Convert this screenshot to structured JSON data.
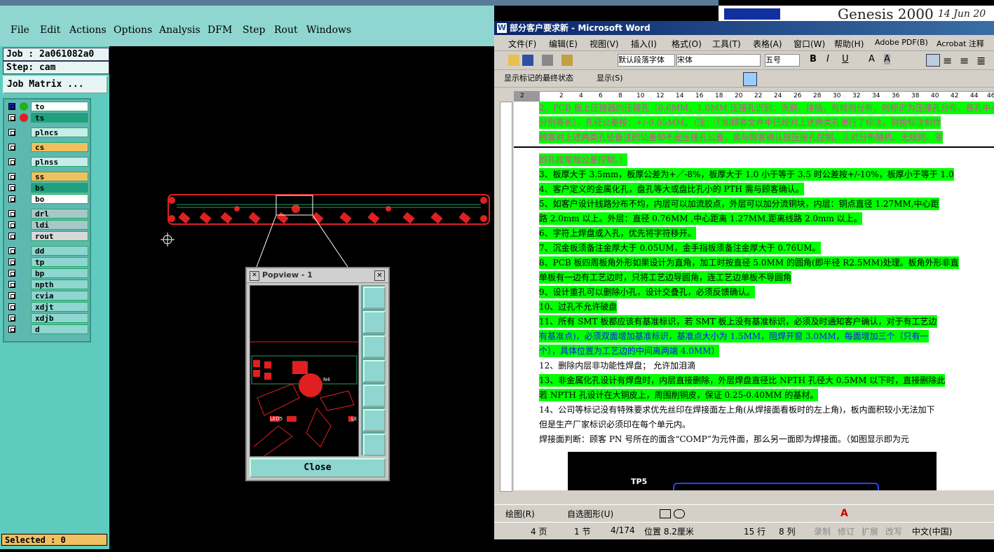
{
  "genesis": {
    "menu": [
      "File",
      "Edit",
      "Actions",
      "Options",
      "Analysis",
      "DFM",
      "Step",
      "Rout",
      "Windows"
    ],
    "job": "Job : 2a061082a0",
    "step": "Step: cam",
    "job_matrix_button": "Job Matrix ...",
    "layers": [
      "to",
      "ts",
      "plncs",
      "cs",
      "plnss",
      "ss",
      "bs",
      "bo",
      "drl",
      "ldi",
      "rout",
      "dd",
      "tp",
      "bp",
      "npth",
      "cvia",
      "xdjt",
      "xdjb",
      "d"
    ],
    "selected": "Selected : 0",
    "brand": "Genesis 2000",
    "date": "14 Jun 20",
    "popview": {
      "title": "Popview - 1",
      "close": "Close",
      "labels": [
        "LED5",
        "LE",
        "N4"
      ]
    }
  },
  "word": {
    "title": "部分客户要求新 - Microsoft Word",
    "menu": [
      "文件(F)",
      "编辑(E)",
      "视图(V)",
      "插入(I)",
      "格式(O)",
      "工具(T)",
      "表格(A)",
      "窗口(W)",
      "帮助(H)",
      "Adobe PDF(B)",
      "Acrobat 注释"
    ],
    "style_box": "默认段落字体",
    "font_box": "宋体",
    "size_box": "五号",
    "review_box": "显示标记的最终状态",
    "show_button": "显示(S)",
    "draw_label": "绘图(R)",
    "autoshape_label": "自选图形(U)",
    "ruler_numbers": [
      "2",
      "2",
      "4",
      "6",
      "8",
      "10",
      "12",
      "14",
      "16",
      "18",
      "20",
      "22",
      "24",
      "26",
      "28",
      "30",
      "32",
      "34",
      "36",
      "38",
      "40",
      "42",
      "44",
      "46"
    ],
    "lines": [
      {
        "t": "2、PCB 板上压接器的压接孔（0.6MM、1.0MM 压接孔识别：派别、排插，有规则分布，则标识为压接孔分布，各孔中心",
        "c": "pink hl"
      },
      {
        "t": "分别等长），孔径公差按：+/-0.05MM。（注：①如顾客文件中已经对上述两类孔进行了标注，则按标注制作",
        "c": "pink hl"
      },
      {
        "t": "顾客对上述两类孔径备注的公差却不是压接孔公差，需与顾客确认按压接孔控制。②对分布随机、无规则、零",
        "c": "pink hl"
      },
      {
        "t": "的孔按常规公差控制。）",
        "c": "pink hl"
      },
      {
        "t": "3、板厚大于 3.5mm，板厚公差为+／-8%，板厚大于 1.0 小于等于 3.5 时公差按+/-10%，板厚小于等于 1.0",
        "c": "hl"
      },
      {
        "t": "4、客户定义的金属化孔，盘孔等大或盘比孔小的 PTH 需与顾客确认。",
        "c": "hl"
      },
      {
        "t": "5、如客户设计线路分布不均，内层可以加流胶点，外层可以加分流铜块，内层：铜点直径 1.27MM,中心距",
        "c": "hl"
      },
      {
        "t": "   路 2.0mm 以上。外层：直径 0.76MM ,中心距离 1.27MM,距离线路 2.0mm 以上。",
        "c": "hl"
      },
      {
        "t": "6、字符上焊盘或入孔，优先将字符移开。",
        "c": "hl"
      },
      {
        "t": "7、沉金板须备注金厚大于 0.05UM，金手指板须备注金厚大于 0.76UM。",
        "c": "hl"
      },
      {
        "t": "8、PCB 板四周板角外形如果设计为直角，加工时按直径 5.0MM 的圆角(即半径 R2.5MM)处理。板角外形非直",
        "c": "hl"
      },
      {
        "t": "单板有一边有工艺边时，只将工艺边导圆角，连工艺边单板不导圆角",
        "c": "hl"
      },
      {
        "t": "9、设计重孔可以删除小孔，设计交叠孔，必须反馈确认。",
        "c": "hl"
      },
      {
        "t": "10、过孔不允许破盘",
        "c": "hl"
      },
      {
        "t": "11、所有 SMT 板都应该有基准标识，若 SMT 板上没有基准标识，必须及时通知客户确认，对于有工艺边",
        "c": "hl"
      },
      {
        "t": "    有基准点)，必须双面增加基准标识，基准点大小为 1.5MM，阻焊开窗 3.0MM，每面增加三个（只有一",
        "c": "hl"
      },
      {
        "t": "    个），具体位置为工艺边的中间离两端 4.0MM）",
        "c": "hl"
      },
      {
        "t": "12、删除内层非功能性焊盘；  允许加泪滴",
        "c": ""
      },
      {
        "t": "13、非金属化孔设计有焊盘时，内层直接删除，外层焊盘直径比 NPTH 孔径大 0.5MM 以下时，直接删除此",
        "c": "hl"
      },
      {
        "t": "    若 NPTH 孔设计在大铜皮上，周围削铜皮，保证 0.25-0.40MM 的基材。",
        "c": "hl"
      },
      {
        "t": "14、公司等标记没有特殊要求优先丝印在焊接面左上角(从焊接面看板时的左上角)，板内面积较小无法加下",
        "c": ""
      },
      {
        "t": "    但是生产厂家标识必须印在每个单元内。",
        "c": ""
      },
      {
        "t": "      焊接面判断：顾客 PN 号所在的面含“COMP”为元件面，那么另一面即为焊接面。（如图显示即为元",
        "c": ""
      }
    ],
    "figure_label": "TP5",
    "status": {
      "page": "4 页",
      "section": "1 节",
      "pages": "4/174",
      "pos": "位置 8.2厘米",
      "row": "15 行",
      "col": "8 列",
      "rec": "录制",
      "rev": "修订",
      "ext": "扩展",
      "ovr": "改写",
      "lang": "中文(中国)"
    }
  }
}
